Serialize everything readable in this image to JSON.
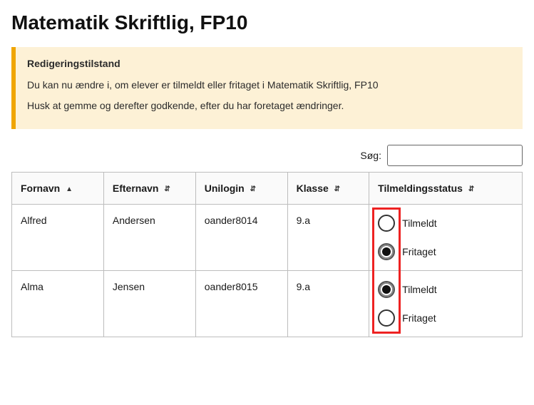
{
  "title": "Matematik Skriftlig, FP10",
  "alert": {
    "heading": "Redigeringstilstand",
    "line1": "Du kan nu ændre i, om elever er tilmeldt eller fritaget i Matematik Skriftlig, FP10",
    "line2": "Husk at gemme og derefter godkende, efter du har foretaget ændringer."
  },
  "search": {
    "label": "Søg:",
    "value": ""
  },
  "columns": {
    "fornavn": "Fornavn",
    "efternavn": "Efternavn",
    "unilogin": "Unilogin",
    "klasse": "Klasse",
    "status": "Tilmeldingsstatus"
  },
  "sort_icons": {
    "asc": "▲",
    "both": "⇵"
  },
  "status_options": {
    "tilmeldt": "Tilmeldt",
    "fritaget": "Fritaget"
  },
  "rows": [
    {
      "fornavn": "Alfred",
      "efternavn": "Andersen",
      "unilogin": "oander8014",
      "klasse": "9.a",
      "status": "fritaget"
    },
    {
      "fornavn": "Alma",
      "efternavn": "Jensen",
      "unilogin": "oander8015",
      "klasse": "9.a",
      "status": "tilmeldt"
    }
  ]
}
